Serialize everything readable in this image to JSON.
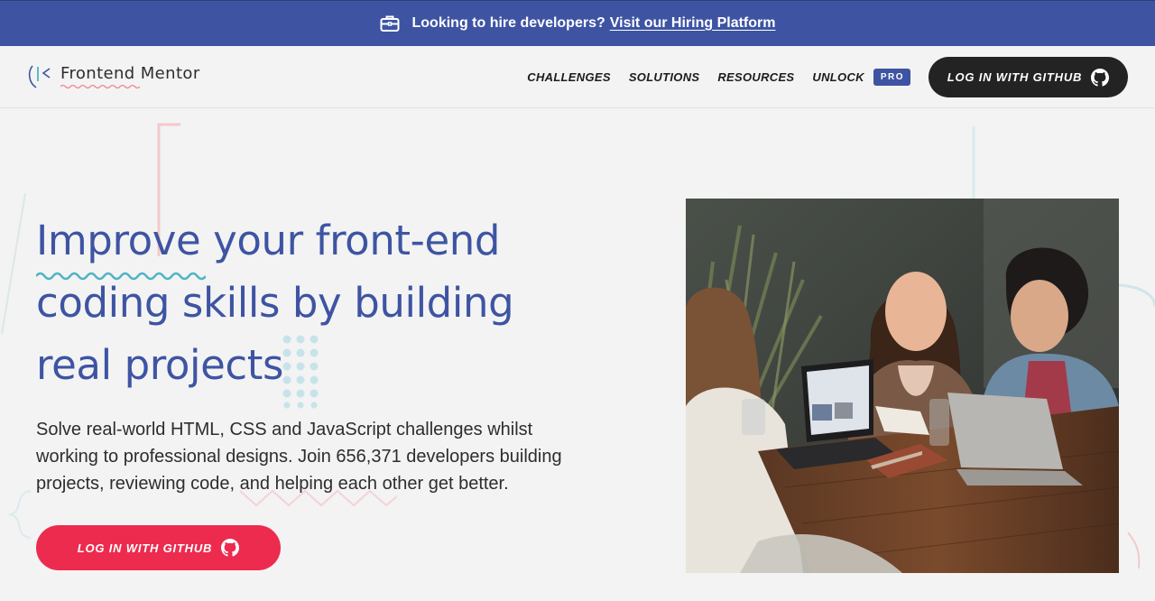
{
  "banner": {
    "icon": "briefcase-icon",
    "text": "Looking to hire developers?",
    "link": "Visit our Hiring Platform",
    "color": "#3e54a3"
  },
  "header": {
    "logo_text": "Frontend Mentor",
    "nav": {
      "challenges": "CHALLENGES",
      "solutions": "SOLUTIONS",
      "resources": "RESOURCES",
      "unlock": "UNLOCK",
      "pro_badge": "PRO"
    },
    "login_button": "LOG IN WITH GITHUB",
    "login_icon": "github-icon"
  },
  "hero": {
    "title_highlight": "Improve",
    "title_line1_rest": " your front-end",
    "title_line2": "coding skills by building",
    "title_line3": "real projects",
    "subtitle": "Solve real-world HTML, CSS and JavaScript challenges whilst working to professional designs. Join 656,371 developers building projects, reviewing code, and helping each other get better.",
    "cta_button": "LOG IN WITH GITHUB",
    "cta_icon": "github-icon",
    "accent_color": "#ec2b4e",
    "title_color": "#3e54a3"
  }
}
